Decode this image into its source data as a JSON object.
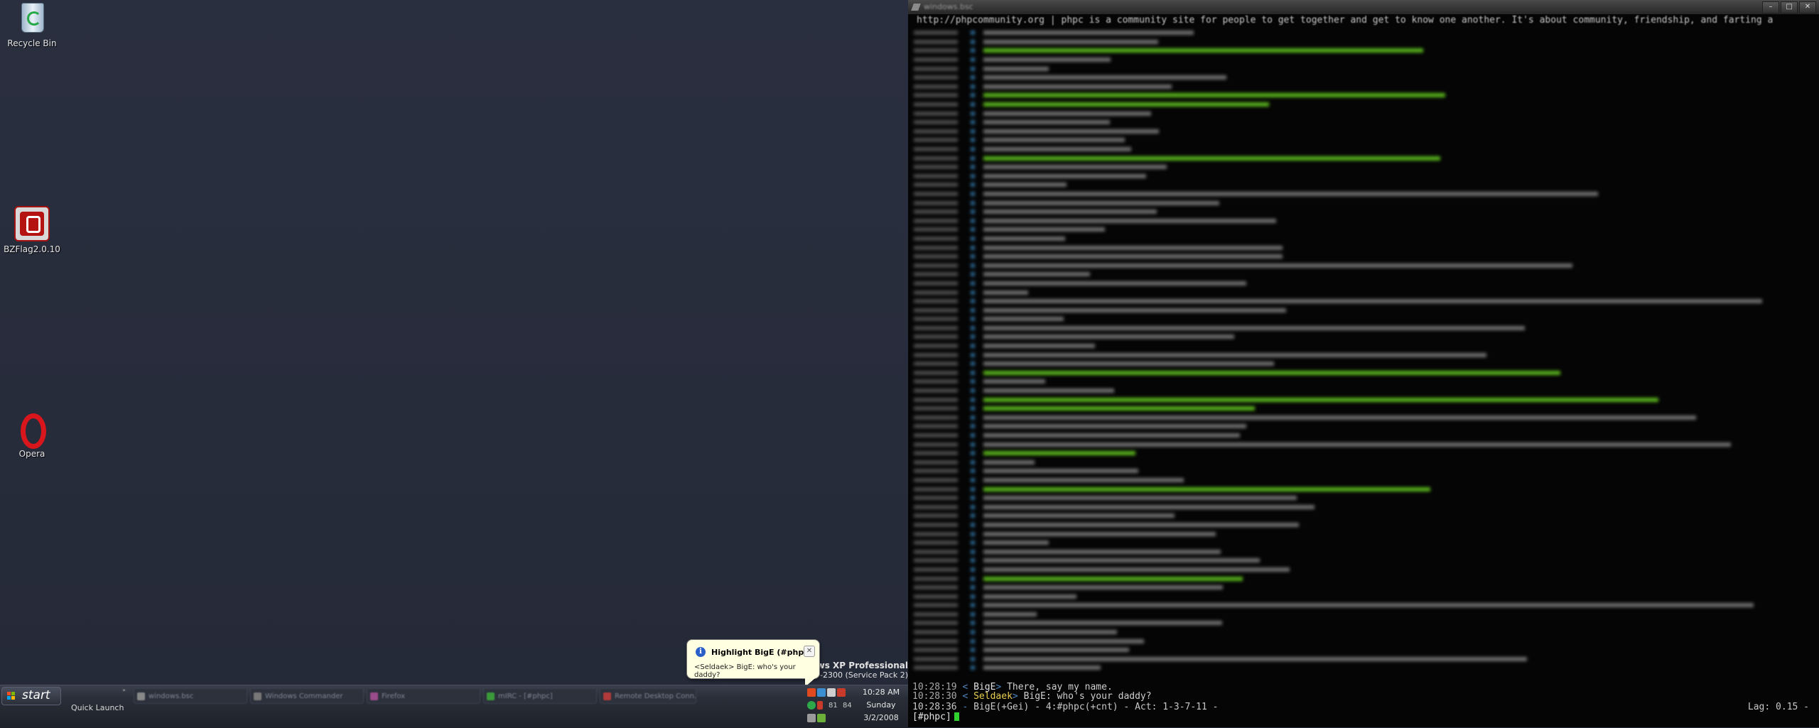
{
  "desktop": {
    "icons": [
      {
        "label": "Recycle Bin"
      },
      {
        "label": "BZFlag2.0.10"
      },
      {
        "label": "Opera"
      }
    ],
    "watermark": {
      "line1": "indows XP Professional",
      "line2": "27-2300 (Service Pack 2)"
    }
  },
  "terminal": {
    "title": "windows.bsc",
    "topic": "http://phpcommunity.org | phpc is a community site for people to get together and get to know one another. It's about community, friendship, and farting a",
    "lines": [
      {
        "time": "10:28:19",
        "nick": "BigE",
        "text": "There, say my name."
      },
      {
        "time": "10:28:30",
        "nick": "Seldaek",
        "text": "BigE: who's your daddy?"
      }
    ],
    "status_prefix": "10:28:36",
    "status_left": "BigE(+Gei) - 4:#phpc(+cnt) - Act: 1-3-7-11 -",
    "status_right": "Lag: 0.15 -",
    "prompt": "[#phpc]"
  },
  "balloon": {
    "title": "Highlight BigE (#phpc)",
    "message": "<Seldaek> BigE: who's your daddy?"
  },
  "taskbar": {
    "start_label": "start",
    "quick_launch_label": "Quick Launch",
    "buttons": [
      {
        "label": "windows.bsc"
      },
      {
        "label": "Windows Commander"
      },
      {
        "label": "Firefox"
      },
      {
        "label": "mIRC - [#phpc]"
      },
      {
        "label": "Remote Desktop Conn..."
      }
    ],
    "tray_numbers": [
      "81",
      "84"
    ],
    "clock": {
      "time": "10:28 AM",
      "day": "Sunday",
      "date": "3/2/2008"
    }
  },
  "colors": {
    "desktop_bg": "#262b3a",
    "terminal_bg": "#050505",
    "highlight_nick": "#e8d050",
    "cursor": "#2fd22f"
  }
}
